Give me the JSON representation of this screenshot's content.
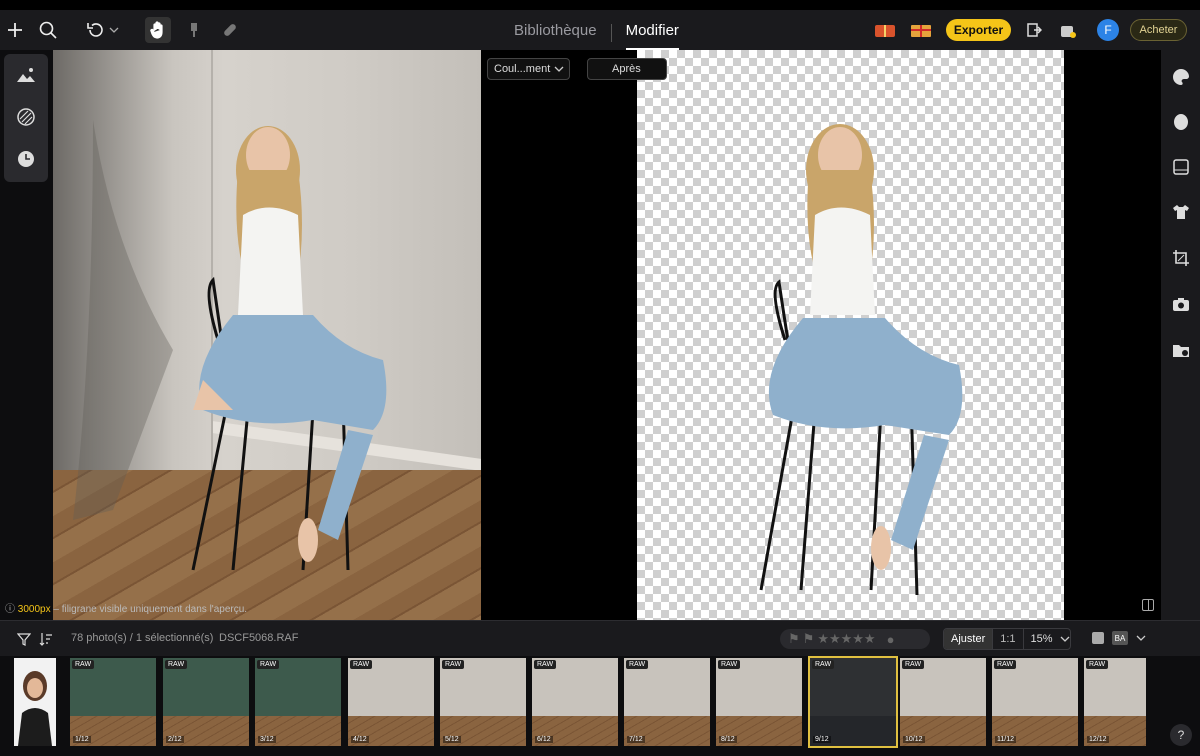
{
  "topbar": {
    "tabs": [
      {
        "label": "Bibliothèque"
      },
      {
        "label": "Modifier"
      }
    ],
    "export_label": "Exporter",
    "buy_label": "Acheter",
    "avatar_letter": "F"
  },
  "canvas": {
    "view_mode": "Coul...ment",
    "after_label": "Après",
    "watermark_px": "3000px",
    "watermark_note": " – filigrane visible uniquement dans l'aperçu."
  },
  "filmstrip": {
    "count_text": "78 photo(s) / 1 sélectionné(s)",
    "filename": "DSCF5068.RAF",
    "zoom_fit": "Ajuster",
    "zoom_one": "1:1",
    "zoom_pct": "15%",
    "ba_label": "BA",
    "rating_stars": "★★★★★",
    "thumbs": [
      {
        "raw": "",
        "num": ""
      },
      {
        "raw": "RAW",
        "num": "1/12"
      },
      {
        "raw": "RAW",
        "num": "2/12"
      },
      {
        "raw": "RAW",
        "num": "3/12"
      },
      {
        "raw": "RAW",
        "num": "4/12"
      },
      {
        "raw": "RAW",
        "num": "5/12"
      },
      {
        "raw": "RAW",
        "num": "6/12"
      },
      {
        "raw": "RAW",
        "num": "7/12"
      },
      {
        "raw": "RAW",
        "num": "8/12"
      },
      {
        "raw": "RAW",
        "num": "9/12"
      },
      {
        "raw": "RAW",
        "num": "10/12"
      },
      {
        "raw": "RAW",
        "num": "11/12"
      },
      {
        "raw": "RAW",
        "num": "12/12"
      }
    ]
  },
  "help_label": "?"
}
